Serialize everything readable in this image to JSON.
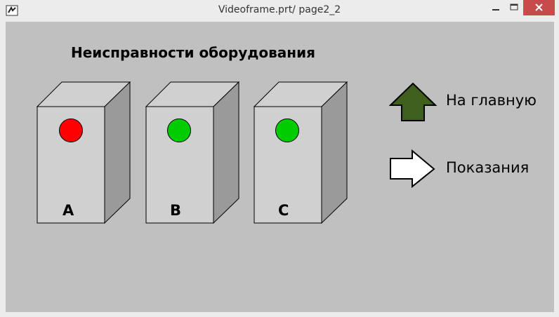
{
  "window": {
    "title": "Videoframe.prt/ page2_2"
  },
  "page": {
    "heading": "Неисправности оборудования"
  },
  "cabinets": [
    {
      "label": "A",
      "status_color": "#ff0000"
    },
    {
      "label": "B",
      "status_color": "#00cc00"
    },
    {
      "label": "C",
      "status_color": "#00cc00"
    }
  ],
  "nav": {
    "home_label": "На главную",
    "home_arrow_color": "#3f5f1c",
    "readings_label": "Показания",
    "readings_arrow_color": "#ffffff"
  }
}
